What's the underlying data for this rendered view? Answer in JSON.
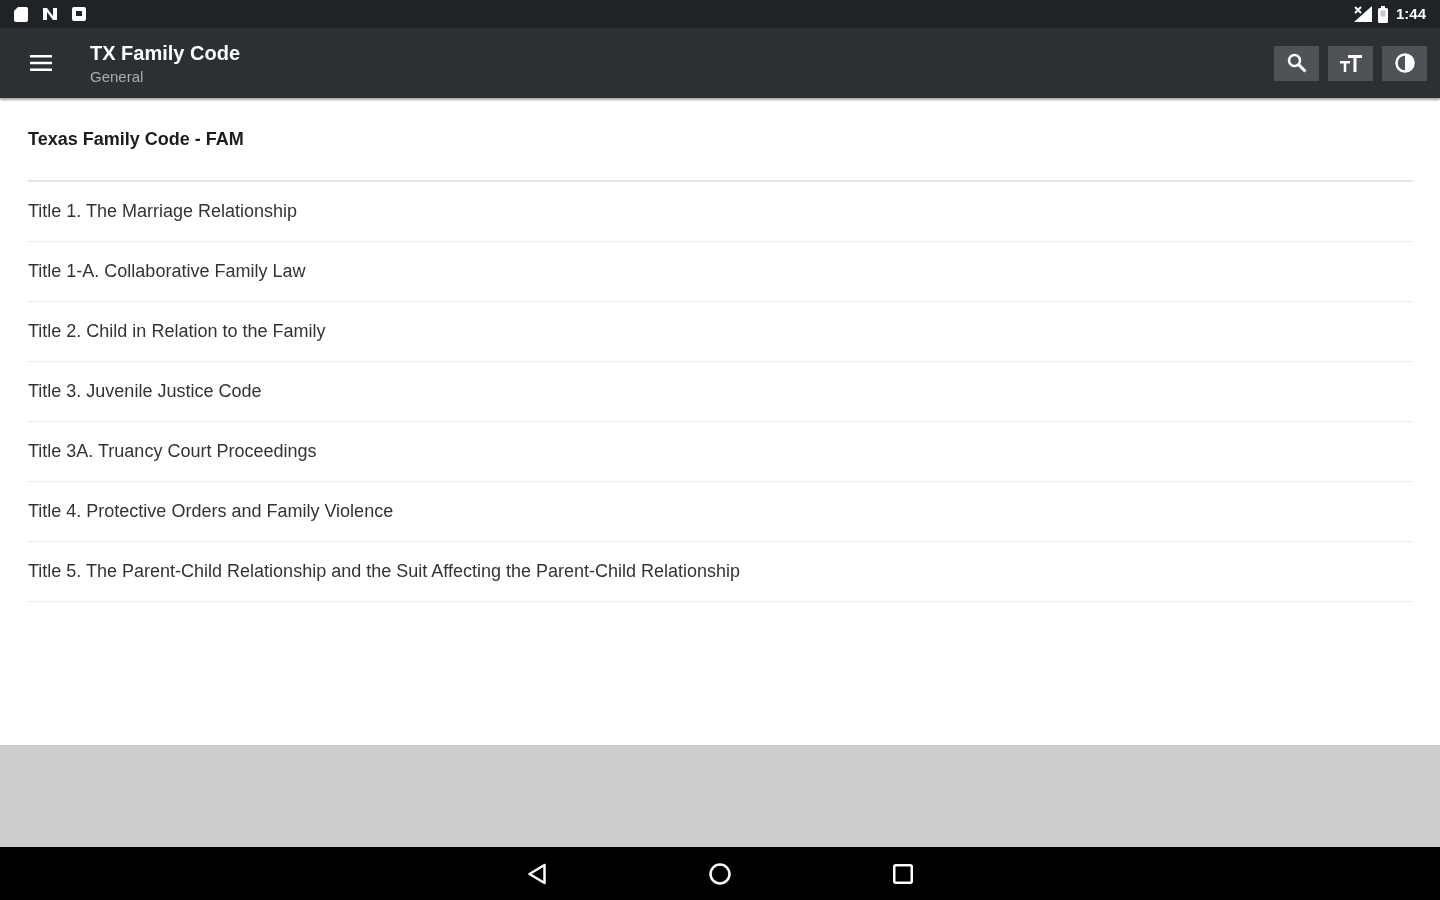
{
  "status_bar": {
    "time": "1:44"
  },
  "toolbar": {
    "title": "TX Family Code",
    "subtitle": "General"
  },
  "list": {
    "heading": "Texas Family Code - FAM",
    "items": [
      "Title 1. The Marriage Relationship",
      "Title 1-A. Collaborative Family Law",
      "Title 2. Child in Relation to the Family",
      "Title 3. Juvenile Justice Code",
      "Title 3A. Truancy Court Proceedings",
      "Title 4. Protective Orders and Family Violence",
      "Title 5. The Parent-Child Relationship and the Suit Affecting the Parent-Child Relationship"
    ]
  }
}
